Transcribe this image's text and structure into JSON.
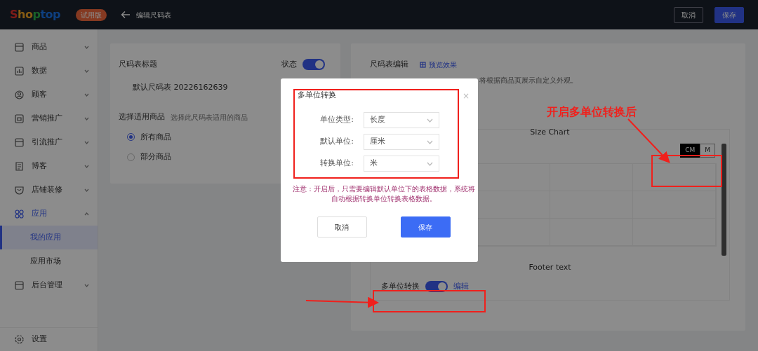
{
  "header": {
    "logo": "Shoptop",
    "badge": "试用版",
    "back_title": "编辑尺码表",
    "buttons": [
      {
        "label": "取消",
        "kind": "outline"
      },
      {
        "label": "保存",
        "kind": "primary"
      }
    ]
  },
  "sidebar": {
    "items": [
      {
        "label": "商品",
        "expanded": false
      },
      {
        "label": "数据",
        "expanded": false
      },
      {
        "label": "顾客",
        "expanded": false
      },
      {
        "label": "营销推广",
        "expanded": false
      },
      {
        "label": "引流推广",
        "expanded": false
      },
      {
        "label": "博客",
        "expanded": false
      },
      {
        "label": "店铺装修",
        "expanded": false
      },
      {
        "label": "应用",
        "expanded": true,
        "children": [
          {
            "label": "我的应用",
            "selected": true
          },
          {
            "label": "应用市场",
            "selected": false
          }
        ]
      },
      {
        "label": "后台管理",
        "expanded": false
      }
    ],
    "footer": {
      "label": "设置"
    }
  },
  "settings_card": {
    "title_label": "尺码表标题",
    "status_label": "状态",
    "status_on": true,
    "title_value": "默认尺码表 20226162639",
    "products_label": "选择适用商品",
    "products_hint": "选择此尺码表适用的商品",
    "options": [
      {
        "label": "所有商品",
        "selected": true
      },
      {
        "label": "部分商品",
        "selected": false
      }
    ]
  },
  "editor_card": {
    "title": "尺码表编辑",
    "preview_link": "预览效果",
    "description": "将根据商品页展示自定义外观。",
    "chart_title": "Size Chart",
    "units": [
      {
        "label": "CM",
        "selected": true
      },
      {
        "label": "M",
        "selected": false
      }
    ],
    "footer": "Footer text",
    "multi_unit_label": "多单位转换",
    "multi_unit_on": true,
    "edit_link": "编辑"
  },
  "annotation": {
    "text": "开启多单位转换后"
  },
  "dialog": {
    "title": "多单位转换",
    "close": "×",
    "fields": [
      {
        "label": "单位类型:",
        "value": "长度"
      },
      {
        "label": "默认单位:",
        "value": "厘米"
      },
      {
        "label": "转换单位:",
        "value": "米"
      }
    ],
    "note": "注意：开启后，只需要编辑默认单位下的表格数据，系统将自动根据转换单位转换表格数据。",
    "buttons": [
      {
        "label": "取消",
        "kind": "outline"
      },
      {
        "label": "保存",
        "kind": "primary"
      }
    ]
  }
}
